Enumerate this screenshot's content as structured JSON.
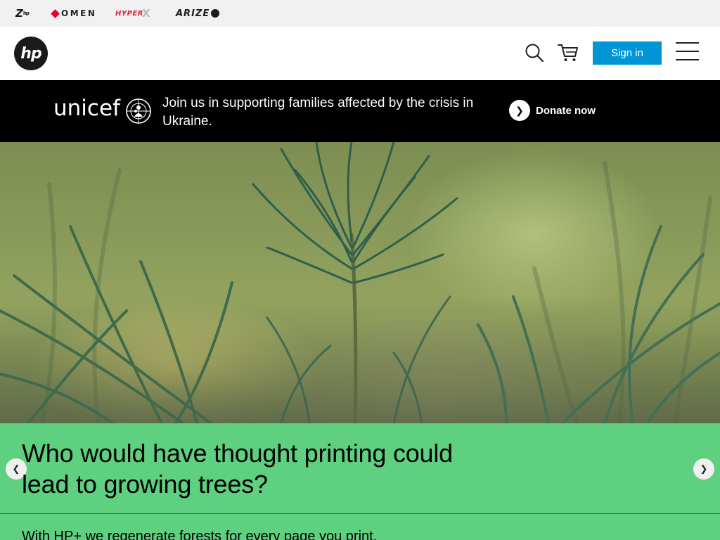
{
  "brands": {
    "z": "Z",
    "z_mark": "hp",
    "omen": "OMEN",
    "hyperx": "HYPER",
    "hyperx_x": "X",
    "arize": "ARIZE"
  },
  "header": {
    "logo_text": "hp",
    "signin_label": "Sign in"
  },
  "promo": {
    "unicef_word": "unicef",
    "message": "Join us in supporting families affected by the crisis in Ukraine.",
    "donate_arrow": "❯",
    "donate_label": "Donate now"
  },
  "hero_panel": {
    "title": "Who would have thought printing could lead to growing trees?",
    "subtitle": "With HP+ we regenerate forests for every page you print.",
    "prev_arrow": "❮",
    "next_arrow": "❯"
  },
  "colors": {
    "brand_strip_bg": "#f1f1f1",
    "signin_bg": "#0096d6",
    "promo_bg": "#000000",
    "panel_bg": "#5fcf80"
  }
}
